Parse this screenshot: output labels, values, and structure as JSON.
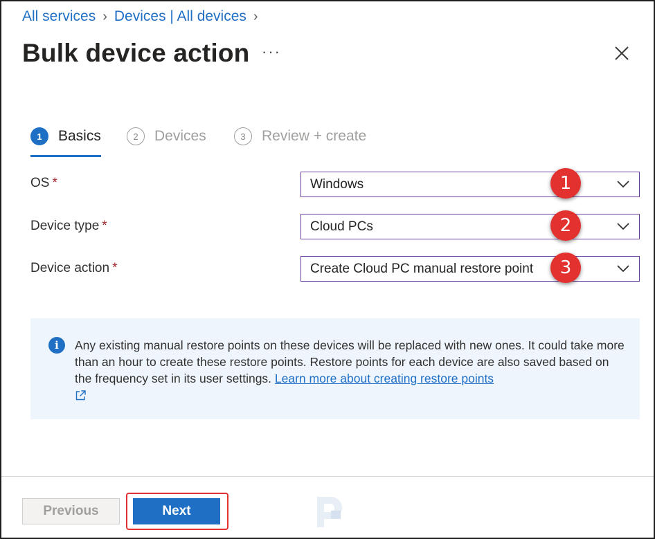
{
  "breadcrumb": {
    "items": [
      "All services",
      "Devices | All devices"
    ]
  },
  "header": {
    "title": "Bulk device action",
    "more_icon": "ellipsis-icon",
    "close_icon": "close-icon"
  },
  "tabs": [
    {
      "number": "1",
      "label": "Basics",
      "active": true
    },
    {
      "number": "2",
      "label": "Devices",
      "active": false
    },
    {
      "number": "3",
      "label": "Review + create",
      "active": false
    }
  ],
  "form": {
    "os": {
      "label": "OS",
      "required": "*",
      "value": "Windows"
    },
    "device_type": {
      "label": "Device type",
      "required": "*",
      "value": "Cloud PCs"
    },
    "device_action": {
      "label": "Device action",
      "required": "*",
      "value": "Create Cloud PC manual restore point"
    }
  },
  "annotations": [
    "1",
    "2",
    "3"
  ],
  "info": {
    "icon": "info-icon",
    "text": "Any existing manual restore points on these devices will be replaced with new ones. It could take more than an hour to create these restore points. Restore points for each device are also saved based on the frequency set in its user settings. ",
    "link_text": "Learn more about creating restore points",
    "link_icon": "external-link-icon"
  },
  "footer": {
    "previous_label": "Previous",
    "next_label": "Next"
  },
  "colors": {
    "accent": "#1f6fc5",
    "annotation_red": "#e3312f",
    "select_border": "#6b3fa0",
    "info_bg": "#eef5fd"
  }
}
